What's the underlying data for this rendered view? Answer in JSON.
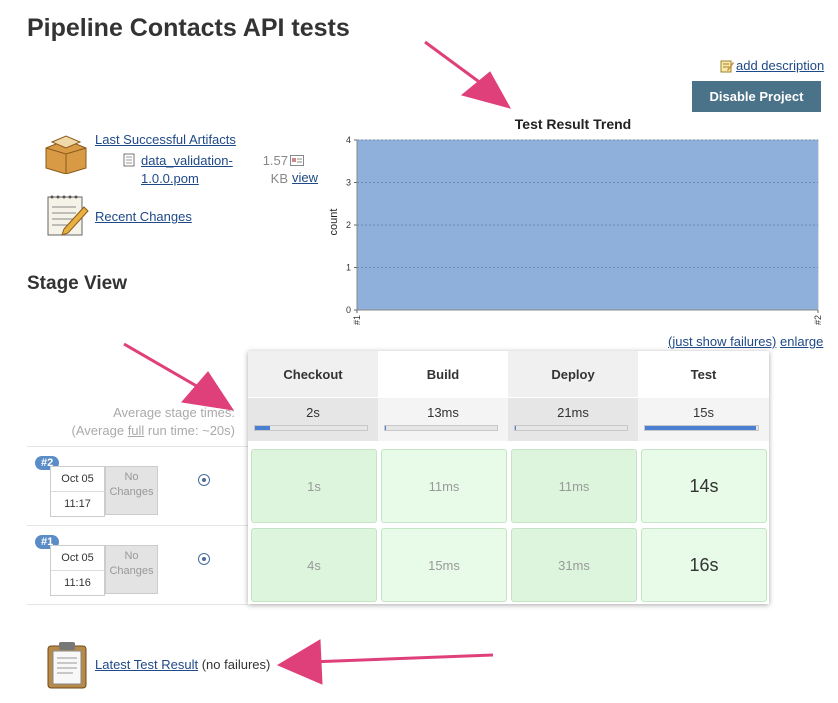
{
  "page": {
    "title": "Pipeline Contacts API tests",
    "add_description": "add description",
    "disable_button": "Disable Project"
  },
  "sidebar": {
    "last_artifacts_label": "Last Successful Artifacts",
    "artifact_name_line1": "data_validation-",
    "artifact_name_line2": "1.0.0.pom",
    "artifact_size_line1": "1.57",
    "artifact_size_line2": "KB",
    "artifact_view": "view",
    "recent_changes": "Recent Changes"
  },
  "stage_view": {
    "title": "Stage View",
    "avg_stage_times": "Average stage times:",
    "avg_run_prefix": "(Average ",
    "avg_run_full": "full",
    "avg_run_suffix": " run time: ~20s)",
    "stages": [
      {
        "name": "Checkout",
        "avg": "2s",
        "avg_fraction": 0.13
      },
      {
        "name": "Build",
        "avg": "13ms",
        "avg_fraction": 0.01
      },
      {
        "name": "Deploy",
        "avg": "21ms",
        "avg_fraction": 0.01
      },
      {
        "name": "Test",
        "avg": "15s",
        "avg_fraction": 0.98
      }
    ],
    "runs": [
      {
        "badge": "#2",
        "date": "Oct 05",
        "time": "11:17",
        "no_changes_1": "No",
        "no_changes_2": "Changes",
        "durations": [
          "1s",
          "11ms",
          "11ms",
          "14s"
        ]
      },
      {
        "badge": "#1",
        "date": "Oct 05",
        "time": "11:16",
        "no_changes_1": "No",
        "no_changes_2": "Changes",
        "durations": [
          "4s",
          "15ms",
          "31ms",
          "16s"
        ]
      }
    ],
    "colors": {
      "cell_success": "#ddf5dd",
      "cell_success_alt": "#e8fbe8",
      "header_alt": "#f0f0f0",
      "accent": "#4a7fd1"
    }
  },
  "trend": {
    "just_show_failures": "(just show failures)",
    "enlarge": "enlarge"
  },
  "chart_data": {
    "type": "area",
    "title": "Test Result Trend",
    "ylabel": "count",
    "xlabel": "",
    "x": [
      "#1",
      "#2"
    ],
    "series": [
      {
        "values": [
          4,
          4
        ]
      }
    ],
    "yticks": [
      "0",
      "1",
      "2",
      "3",
      "4"
    ],
    "ylim": [
      0,
      4
    ],
    "fill_color": "#8eb0da",
    "grid": true
  },
  "footer": {
    "latest_test_result": "Latest Test Result",
    "no_failures": "(no failures)"
  },
  "annotations": {
    "arrow_color": "#e0407a"
  }
}
